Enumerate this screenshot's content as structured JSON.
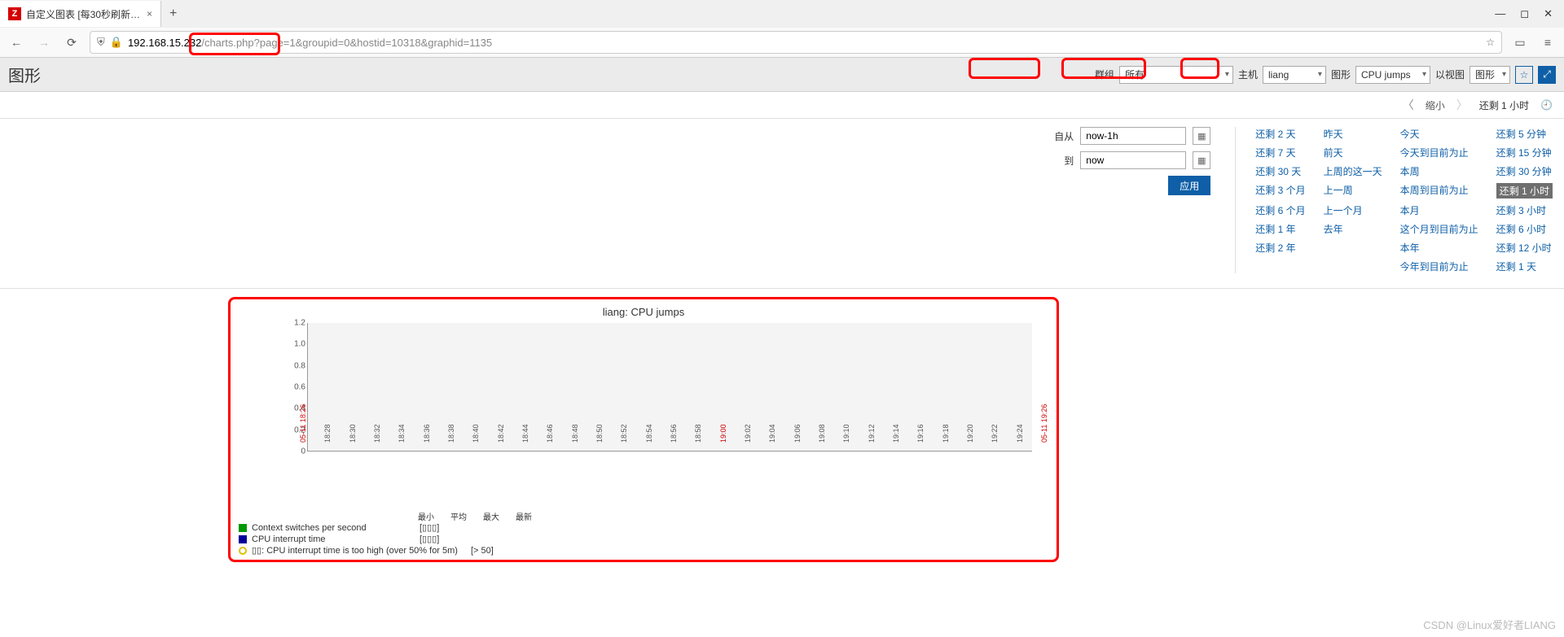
{
  "browser": {
    "tab_title": "自定义图表 [每30秒刷新…",
    "favicon_letter": "Z",
    "url_host": "192.168.15.232",
    "url_path": "/charts.php?page=1&groupid=0&hostid=10318&graphid=1135"
  },
  "header": {
    "title": "图形",
    "group_label": "群组",
    "group_value": "所有",
    "host_label": "主机",
    "host_value": "liang",
    "graph_label": "图形",
    "graph_value": "CPU jumps",
    "view_label": "以视图",
    "view_value": "图形"
  },
  "timenav": {
    "zoom_out": "缩小",
    "range": "还剩 1 小时"
  },
  "timepicker": {
    "from_label": "自从",
    "from_value": "now-1h",
    "to_label": "到",
    "to_value": "now",
    "apply": "应用",
    "presets": {
      "col1": [
        "还剩 2 天",
        "还剩 7 天",
        "还剩 30 天",
        "还剩 3 个月",
        "还剩 6 个月",
        "还剩 1 年",
        "还剩 2 年"
      ],
      "col2": [
        "昨天",
        "前天",
        "上周的这一天",
        "上一周",
        "上一个月",
        "去年",
        ""
      ],
      "col3": [
        "今天",
        "今天到目前为止",
        "本周",
        "本周到目前为止",
        "本月",
        "这个月到目前为止",
        "本年",
        "今年到目前为止"
      ],
      "col4": [
        "还剩 5 分钟",
        "还剩 15 分钟",
        "还剩 30 分钟",
        "还剩 1 小时",
        "还剩 3 小时",
        "还剩 6 小时",
        "还剩 12 小时",
        "还剩 1 天"
      ]
    },
    "active": "还剩 1 小时"
  },
  "chart_data": {
    "type": "line",
    "title": "liang: CPU jumps",
    "ylim": [
      0,
      1.2
    ],
    "yticks": [
      0,
      0.2,
      0.4,
      0.6,
      0.8,
      1.0,
      1.2
    ],
    "x_start": "05-11 18:26",
    "x_end": "05-11 19:26",
    "xticks": [
      "05-11 18:26",
      "18:28",
      "18:30",
      "18:32",
      "18:34",
      "18:36",
      "18:38",
      "18:40",
      "18:42",
      "18:44",
      "18:46",
      "18:48",
      "18:50",
      "18:52",
      "18:54",
      "18:56",
      "18:58",
      "19:00",
      "19:02",
      "19:04",
      "19:06",
      "19:08",
      "19:10",
      "19:12",
      "19:14",
      "19:16",
      "19:18",
      "19:20",
      "19:22",
      "19:24",
      "05-11 19:26"
    ],
    "xticks_red": [
      "05-11 18:26",
      "19:00",
      "05-11 19:26"
    ],
    "series": [
      {
        "name": "Context switches per second",
        "color": "#009900",
        "values": []
      },
      {
        "name": "CPU interrupt time",
        "color": "#000099",
        "values": []
      }
    ],
    "legend_cols": [
      "最小",
      "平均",
      "最大",
      "最新"
    ],
    "legend_vals": [
      "[▯▯▯]",
      "[▯▯▯]"
    ],
    "trigger": {
      "label": "▯▯: CPU interrupt time is too high (over 50% for 5m)",
      "cond": "[> 50]",
      "color": "#e0c000"
    }
  },
  "footer": "CSDN @Linux爱好者LIANG"
}
